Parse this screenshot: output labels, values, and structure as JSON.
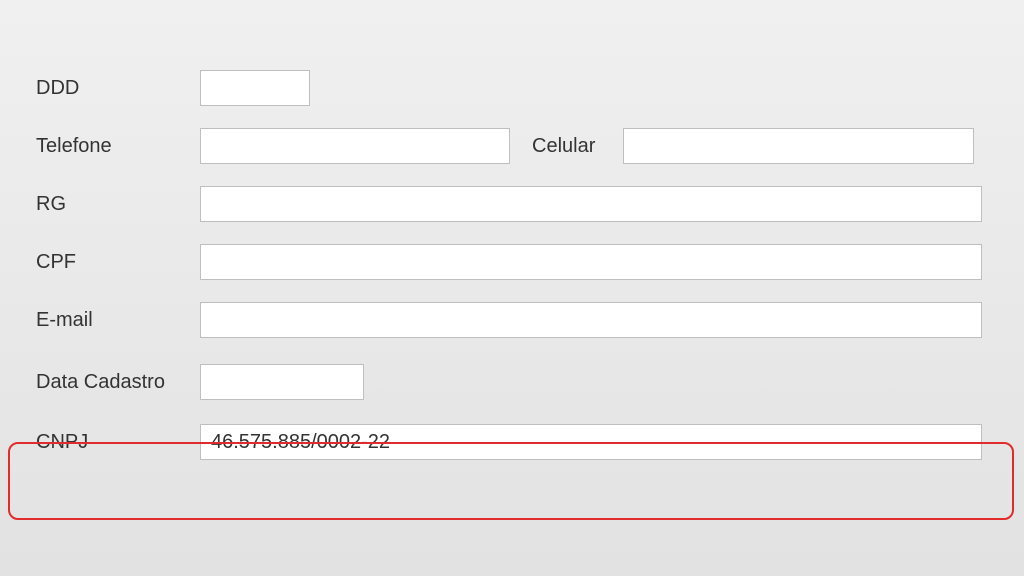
{
  "form": {
    "ddd": {
      "label": "DDD",
      "value": ""
    },
    "telefone": {
      "label": "Telefone",
      "value": ""
    },
    "celular": {
      "label": "Celular",
      "value": ""
    },
    "rg": {
      "label": "RG",
      "value": ""
    },
    "cpf": {
      "label": "CPF",
      "value": ""
    },
    "email": {
      "label": "E-mail",
      "value": ""
    },
    "datacadastro": {
      "label": "Data Cadastro",
      "value": ""
    },
    "cnpj": {
      "label": "CNPJ",
      "value": "46.575.885/0002-22"
    }
  }
}
